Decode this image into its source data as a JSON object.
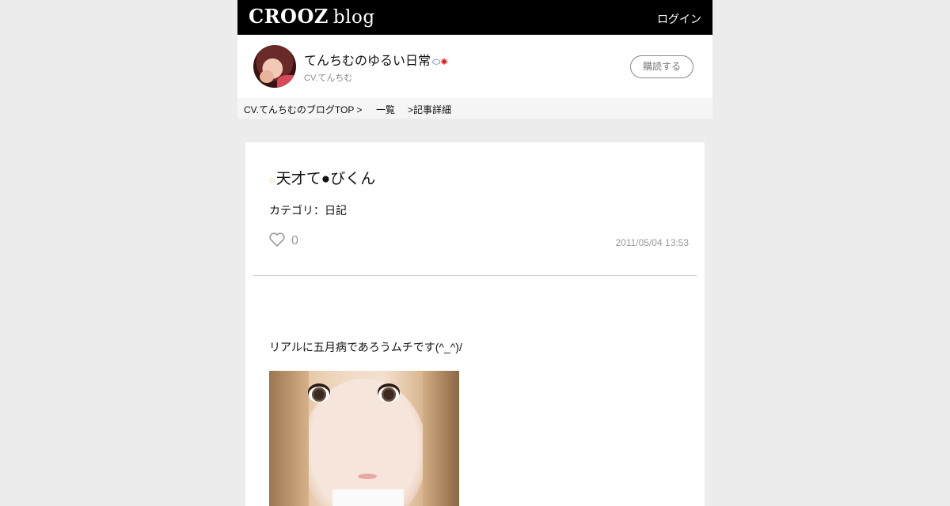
{
  "header": {
    "logo_main": "CROOZ",
    "logo_sub": "blog",
    "login_label": "ログイン"
  },
  "profile": {
    "blog_title": "てんちむのゆるい日常",
    "title_emoji_1": "⬭",
    "title_emoji_2": "☀",
    "author": "CV.てんちむ",
    "subscribe_label": "購読する"
  },
  "breadcrumb": {
    "top": "CV.てんちむのブログTOP >",
    "list": "一覧",
    "detail": ">記事詳細"
  },
  "article": {
    "title_icon": "◌",
    "title": "天才て●びくん",
    "category": "カテゴリ：日記",
    "like_count": "0",
    "date": "2011/05/04 13:53",
    "body_text": "リアルに五月病であろうムチです(^_^)/"
  },
  "colors": {
    "topbar": "#000000",
    "page_bg": "#ececec",
    "breadcrumb_bg": "#f5f5f5",
    "muted_text": "#999999"
  },
  "icons": {
    "like": "heart-outline-icon",
    "title": "chick-emoji-icon"
  }
}
